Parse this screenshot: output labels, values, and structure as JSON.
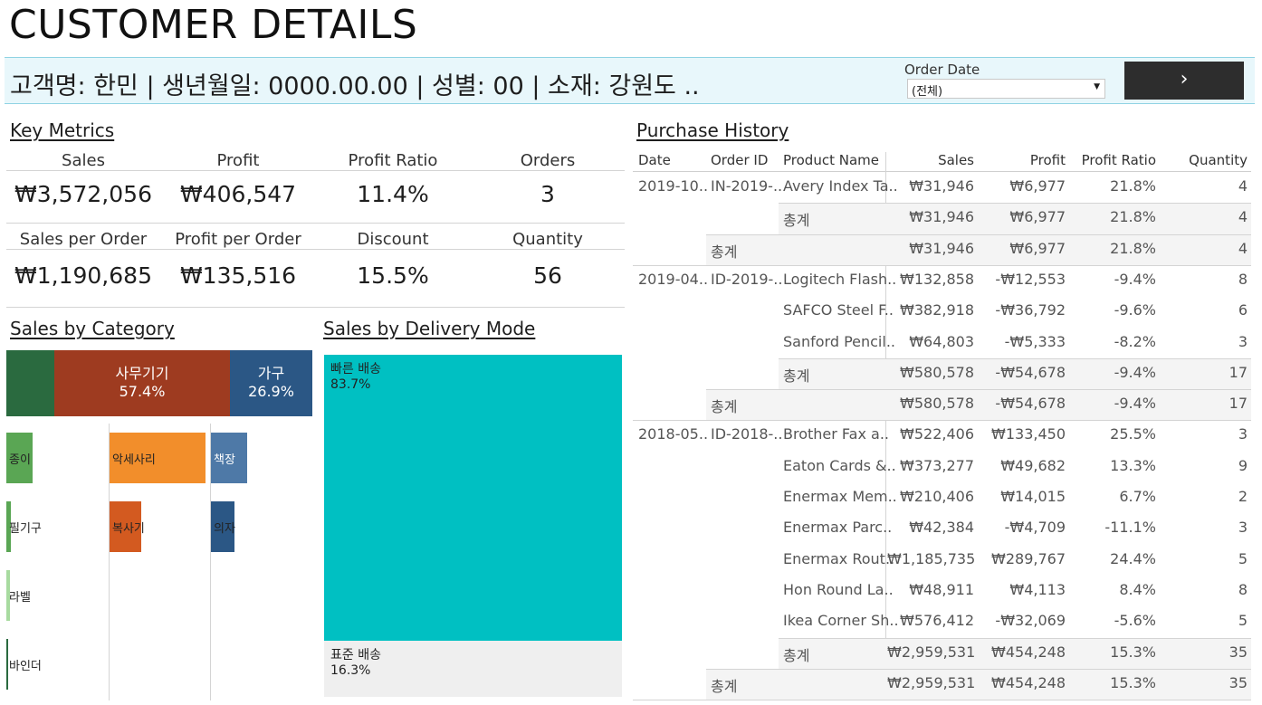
{
  "title": "CUSTOMER DETAILS",
  "customer_info": "고객명: 한민 | 생년월일: 0000.00.00 | 성별: 00 | 소재: 강원도 ..",
  "order_date_filter": {
    "label": "Order Date",
    "value": "(전체)"
  },
  "nav_button": "›",
  "key_metrics": {
    "title": "Key Metrics",
    "row1": [
      {
        "label": "Sales",
        "value": "₩3,572,056"
      },
      {
        "label": "Profit",
        "value": "₩406,547"
      },
      {
        "label": "Profit Ratio",
        "value": "11.4%"
      },
      {
        "label": "Orders",
        "value": "3"
      }
    ],
    "row2": [
      {
        "label": "Sales per Order",
        "value": "₩1,190,685"
      },
      {
        "label": "Profit per Order",
        "value": "₩135,516"
      },
      {
        "label": "Discount",
        "value": "15.5%"
      },
      {
        "label": "Quantity",
        "value": "56"
      }
    ]
  },
  "sales_by_category": {
    "title": "Sales by Category",
    "top": [
      {
        "name": "",
        "pct": "",
        "color": "#2a6a3f"
      },
      {
        "name": "사무기기",
        "pct": "57.4%",
        "color": "#9e3b20"
      },
      {
        "name": "가구",
        "pct": "26.9%",
        "color": "#2b5785"
      }
    ],
    "subs": [
      {
        "name": "종이",
        "color": "#5aa654"
      },
      {
        "name": "필기구",
        "color": "#5aa654"
      },
      {
        "name": "라벨",
        "color": "#a8dba0"
      },
      {
        "name": "바인더",
        "color": "#2a6a3f"
      },
      {
        "name": "악세사리",
        "color": "#f28e2b"
      },
      {
        "name": "복사기",
        "color": "#d35a20"
      },
      {
        "name": "책장",
        "color": "#4e79a7"
      },
      {
        "name": "의자",
        "color": "#2b5785"
      }
    ]
  },
  "sales_by_delivery": {
    "title": "Sales by Delivery Mode",
    "items": [
      {
        "name": "빠른 배송",
        "pct": "83.7%",
        "share": 0.837,
        "color": "#00c0c2"
      },
      {
        "name": "표준 배송",
        "pct": "16.3%",
        "share": 0.163,
        "color": "#efefef"
      }
    ]
  },
  "purchase_history": {
    "title": "Purchase History",
    "headers": [
      "Date",
      "Order ID",
      "Product Name",
      "Sales",
      "Profit",
      "Profit Ratio",
      "Quantity"
    ],
    "rows": [
      [
        "2019-10..",
        "IN-2019-..",
        "Avery Index Ta..",
        "₩31,946",
        "₩6,977",
        "21.8%",
        "4"
      ],
      [
        "",
        "",
        "총계",
        "₩31,946",
        "₩6,977",
        "21.8%",
        "4"
      ],
      [
        "",
        "총계",
        "",
        "₩31,946",
        "₩6,977",
        "21.8%",
        "4"
      ],
      [
        "2019-04..",
        "ID-2019-..",
        "Logitech Flash..",
        "₩132,858",
        "-₩12,553",
        "-9.4%",
        "8"
      ],
      [
        "",
        "",
        "SAFCO Steel F..",
        "₩382,918",
        "-₩36,792",
        "-9.6%",
        "6"
      ],
      [
        "",
        "",
        "Sanford Pencil..",
        "₩64,803",
        "-₩5,333",
        "-8.2%",
        "3"
      ],
      [
        "",
        "",
        "총계",
        "₩580,578",
        "-₩54,678",
        "-9.4%",
        "17"
      ],
      [
        "",
        "총계",
        "",
        "₩580,578",
        "-₩54,678",
        "-9.4%",
        "17"
      ],
      [
        "2018-05..",
        "ID-2018-..",
        "Brother Fax a..",
        "₩522,406",
        "₩133,450",
        "25.5%",
        "3"
      ],
      [
        "",
        "",
        "Eaton Cards &..",
        "₩373,277",
        "₩49,682",
        "13.3%",
        "9"
      ],
      [
        "",
        "",
        "Enermax Mem..",
        "₩210,406",
        "₩14,015",
        "6.7%",
        "2"
      ],
      [
        "",
        "",
        "Enermax Parc..",
        "₩42,384",
        "-₩4,709",
        "-11.1%",
        "3"
      ],
      [
        "",
        "",
        "Enermax Rout..",
        "₩1,185,735",
        "₩289,767",
        "24.4%",
        "5"
      ],
      [
        "",
        "",
        "Hon Round La..",
        "₩48,911",
        "₩4,113",
        "8.4%",
        "8"
      ],
      [
        "",
        "",
        "Ikea Corner Sh..",
        "₩576,412",
        "-₩32,069",
        "-5.6%",
        "5"
      ],
      [
        "",
        "",
        "총계",
        "₩2,959,531",
        "₩454,248",
        "15.3%",
        "35"
      ],
      [
        "",
        "총계",
        "",
        "₩2,959,531",
        "₩454,248",
        "15.3%",
        "35"
      ]
    ]
  }
}
